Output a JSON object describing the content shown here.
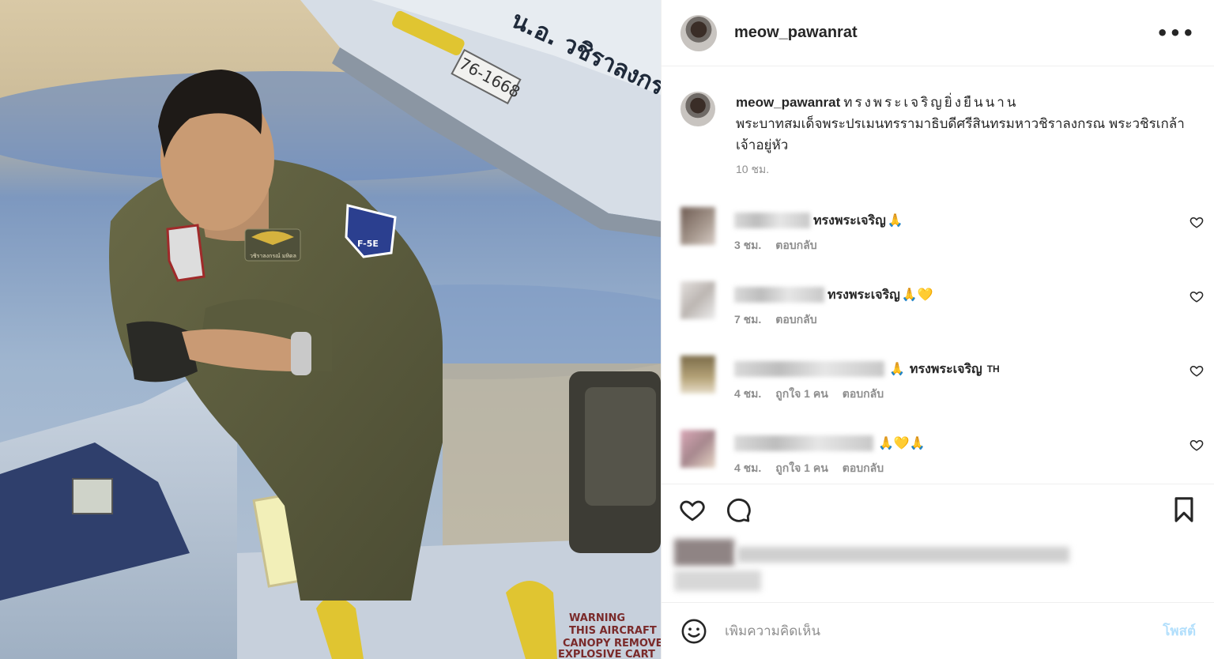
{
  "post": {
    "username": "meow_pawanrat",
    "more_label": "•••",
    "photo_alt": "Pilot in flight suit climbing out of a jet cockpit",
    "photo_text": {
      "canopy_name": "น.อ. วชิราลงกรณ์",
      "canopy_number": "76-1668",
      "name_tag": "วชิราลงกรณ์ มหิดล",
      "patch": "F-5E",
      "warning": [
        "WARNING",
        "THIS AIRCRAFT",
        "CANOPY REMOVER",
        "EXPLOSIVE CART"
      ]
    }
  },
  "caption": {
    "username": "meow_pawanrat",
    "title": "ทรงพระเจริญยิ่งยืนนาน",
    "body": "พระบาทสมเด็จพระปรเมนทรรามาธิบดีศรีสินทรมหาวชิราลงกรณ พระวชิรเกล้าเจ้าอยู่หัว",
    "time": "10 ชม."
  },
  "comments": [
    {
      "text": "ทรงพระเจริญ",
      "emoji": "🙏",
      "time": "3 ชม.",
      "likes": "",
      "reply": "ตอบกลับ"
    },
    {
      "text": "ทรงพระเจริญ",
      "emoji": "🙏💛",
      "time": "7 ชม.",
      "likes": "",
      "reply": "ตอบกลับ"
    },
    {
      "text": "ทรงพระเจริญ",
      "emoji_before": "🙏",
      "suffix": "TH",
      "time": "4 ชม.",
      "likes": "ถูกใจ 1 คน",
      "reply": "ตอบกลับ"
    },
    {
      "text": "",
      "emoji": "🙏💛🙏",
      "time": "4 ชม.",
      "likes": "ถูกใจ 1 คน",
      "reply": "ตอบกลับ"
    }
  ],
  "add_comment": {
    "placeholder": "เพิ่มความคิดเห็น",
    "post_label": "โพสต์"
  },
  "icons": {
    "like": "heart-icon",
    "comment": "comment-icon",
    "save": "bookmark-icon",
    "emoji": "smiley-icon",
    "more": "ellipsis-icon"
  },
  "colors": {
    "text": "#262626",
    "secondary": "#8e8e8e",
    "post_button": "#b2dffc",
    "border": "#efefef"
  }
}
